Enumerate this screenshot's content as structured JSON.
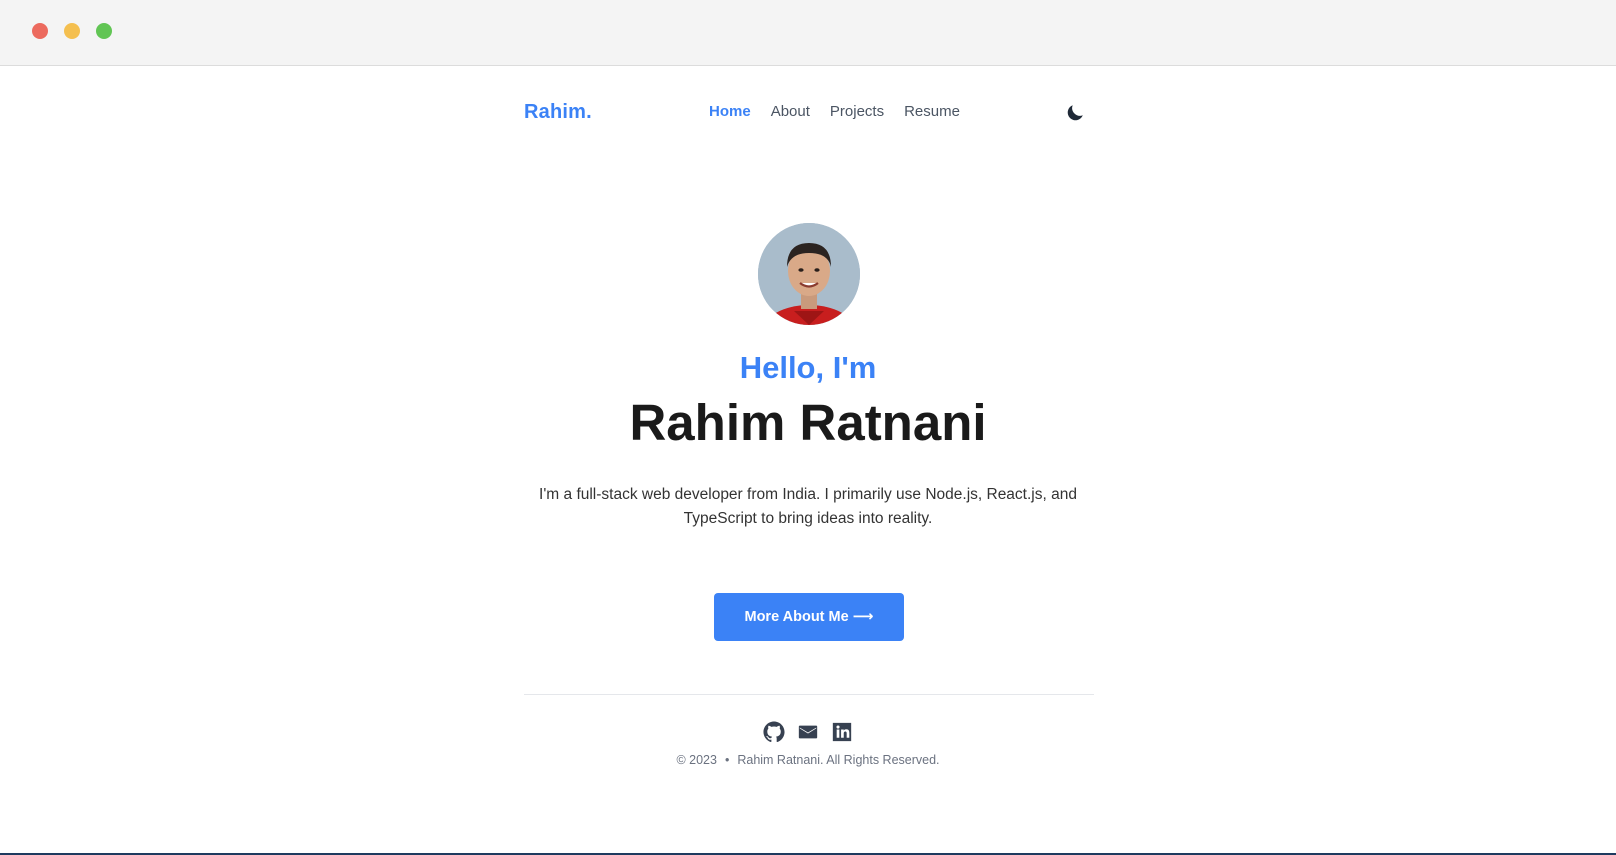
{
  "window": {
    "controls": [
      "close",
      "minimize",
      "maximize"
    ]
  },
  "nav": {
    "logo": "Rahim.",
    "links": [
      {
        "label": "Home",
        "active": true
      },
      {
        "label": "About",
        "active": false
      },
      {
        "label": "Projects",
        "active": false
      },
      {
        "label": "Resume",
        "active": false
      }
    ],
    "theme_toggle_icon": "moon-icon"
  },
  "hero": {
    "greeting": "Hello, I'm",
    "name": "Rahim Ratnani",
    "bio": "I'm a full-stack web developer from India. I primarily use Node.js, React.js, and TypeScript to bring ideas into reality.",
    "cta_label": "More About Me",
    "cta_arrow": "⟶"
  },
  "footer": {
    "social_icons": [
      "github-icon",
      "mail-icon",
      "linkedin-icon"
    ],
    "year": "© 2023",
    "separator": "•",
    "rights": "Rahim Ratnani. All Rights Reserved."
  },
  "colors": {
    "accent": "#3b82f6",
    "heading": "#1a1a1a",
    "text": "#333333",
    "muted": "#6b7280"
  }
}
